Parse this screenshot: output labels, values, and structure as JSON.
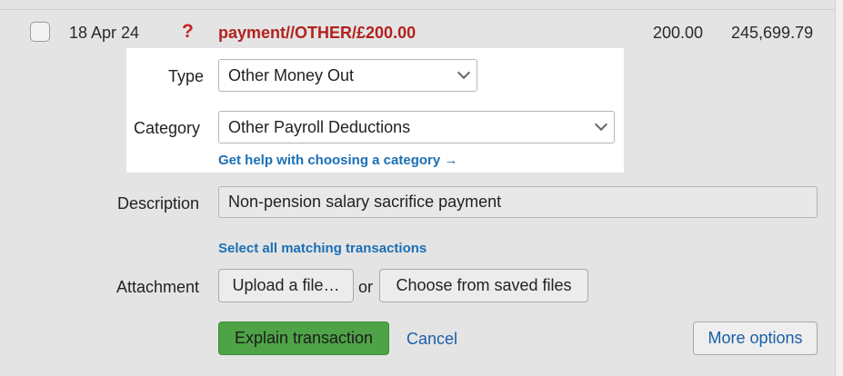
{
  "transaction": {
    "date": "18 Apr 24",
    "status_mark": "?",
    "description": "payment//OTHER/£200.00",
    "amount": "200.00",
    "balance": "245,699.79"
  },
  "form": {
    "type_label": "Type",
    "type_value": "Other Money Out",
    "category_label": "Category",
    "category_value": "Other Payroll Deductions",
    "help_link": "Get help with choosing a category →",
    "description_label": "Description",
    "description_value": "Non-pension salary sacrifice payment",
    "select_matching_link": "Select all matching transactions",
    "attachment_label": "Attachment",
    "upload_button": "Upload a file…",
    "or_text": "or",
    "saved_files_button": "Choose from saved files"
  },
  "actions": {
    "explain_button": "Explain transaction",
    "cancel_link": "Cancel",
    "more_options_button": "More options"
  },
  "colors": {
    "highlight_bg": "#ffffff",
    "panel_bg": "#e4e4e4",
    "alert_red": "#b3221e",
    "link_blue": "#1b6fb5",
    "primary_green": "#4ea346"
  },
  "icons": {
    "select_arrow": "chevron-down-icon",
    "checkbox": "checkbox"
  }
}
